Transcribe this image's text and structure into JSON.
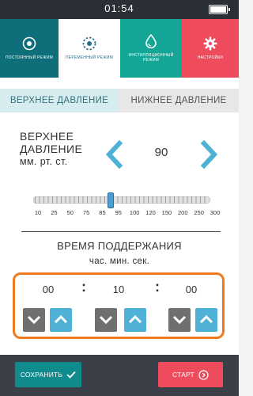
{
  "status_bar": {
    "time": "01:54",
    "battery_level": 1.0
  },
  "modes": [
    {
      "label": "ПОСТОЯННЫЙ РЕЖИМ",
      "icon": "target-icon"
    },
    {
      "label": "ПЕРЕМЕННЫЙ РЕЖИМ",
      "icon": "dotted-circle-icon",
      "selected": true
    },
    {
      "label": "ИНСТИЛЛЯЦИОННЫЙ РЕЖИМ",
      "icon": "drop-icon"
    },
    {
      "label": "НАСТРОЙКИ",
      "icon": "gear-icon"
    }
  ],
  "pressure_tabs": {
    "upper": "ВЕРХНЕЕ ДАВЛЕНИЕ",
    "lower": "НИЖНЕЕ ДАВЛЕНИЕ",
    "active": "upper"
  },
  "pressure": {
    "label_line1": "ВЕРХНЕЕ",
    "label_line2": "ДАВЛЕНИЕ",
    "unit": "мм. рт. ст.",
    "value": "90",
    "slider": {
      "min": 10,
      "max": 300,
      "value": 90
    },
    "scale_labels": [
      "10",
      "25",
      "50",
      "75",
      "85",
      "95",
      "100",
      "120",
      "150",
      "200",
      "250",
      "300"
    ]
  },
  "hold_time": {
    "title": "ВРЕМЯ ПОДДЕРЖАНИЯ",
    "units": "час. мин. сек.",
    "hours": "00",
    "minutes": "10",
    "seconds": "00"
  },
  "footer": {
    "save_label": "СОХРАНИТЬ",
    "start_label": "СТАРТ"
  },
  "colors": {
    "status_bar": "#2a2f36",
    "mode_const": "#0e6f7a",
    "mode_instill": "#13a596",
    "mode_settings": "#ee4b5d",
    "accent_blue": "#4fb1d6",
    "timer_border": "#f07a1f",
    "footer": "#3b3f47"
  }
}
